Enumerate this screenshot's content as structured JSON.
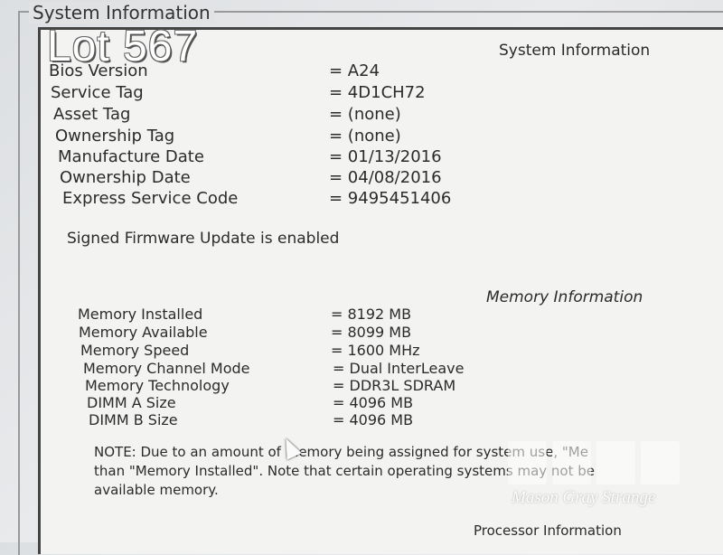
{
  "groupbox": {
    "title": "System Information"
  },
  "overlay": {
    "lot": "Lot 567"
  },
  "system": {
    "title": "System Information",
    "rows": [
      {
        "label": "Bios Version",
        "value": "= A24"
      },
      {
        "label": "Service Tag",
        "value": "= 4D1CH72"
      },
      {
        "label": "Asset Tag",
        "value": "= (none)"
      },
      {
        "label": "Ownership Tag",
        "value": "= (none)"
      },
      {
        "label": "Manufacture Date",
        "value": "= 01/13/2016"
      },
      {
        "label": "Ownership Date",
        "value": "= 04/08/2016"
      },
      {
        "label": "Express Service Code",
        "value": "= 9495451406"
      }
    ],
    "firmware": "Signed Firmware Update is enabled"
  },
  "memory": {
    "title": "Memory Information",
    "rows": [
      {
        "label": "Memory Installed",
        "value": "= 8192 MB"
      },
      {
        "label": "Memory Available",
        "value": "= 8099 MB"
      },
      {
        "label": "Memory Speed",
        "value": "= 1600 MHz"
      },
      {
        "label": "Memory Channel Mode",
        "value": "= Dual InterLeave"
      },
      {
        "label": "Memory Technology",
        "value": "= DDR3L SDRAM"
      },
      {
        "label": "DIMM A Size",
        "value": "= 4096 MB"
      },
      {
        "label": "DIMM B Size",
        "value": "= 4096 MB"
      }
    ],
    "note_lines": [
      "NOTE: Due to an amount of memory being assigned for system use, \"Me",
      "than \"Memory Installed\". Note that certain operating systems may not be",
      "available memory."
    ]
  },
  "processor": {
    "title": "Processor Information"
  },
  "watermark": {
    "text": "Mason Gray Strange"
  }
}
